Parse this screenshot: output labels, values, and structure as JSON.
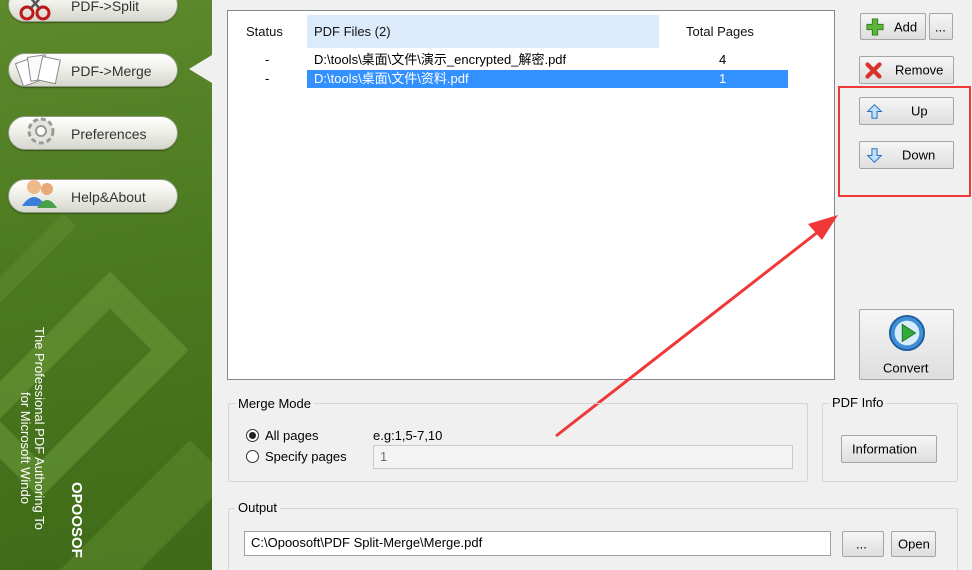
{
  "sidebar": {
    "items": [
      {
        "label": "PDF->Split",
        "icon": "scissors-icon"
      },
      {
        "label": "PDF->Merge",
        "icon": "pages-merge-icon"
      },
      {
        "label": "Preferences",
        "icon": "gear-icon"
      },
      {
        "label": "Help&About",
        "icon": "users-icon"
      }
    ],
    "tagline_line1": "The Professional PDF Authoring To",
    "tagline_line2": "for Microsoft Windo",
    "brand": "OPOOSOF"
  },
  "file_list": {
    "headers": {
      "status": "Status",
      "files": "PDF Files (2)",
      "pages": "Total Pages"
    },
    "rows": [
      {
        "status": "-",
        "file": "D:\\tools\\桌面\\文件\\演示_encrypted_解密.pdf",
        "pages": "4",
        "selected": false
      },
      {
        "status": "-",
        "file": "D:\\tools\\桌面\\文件\\资料.pdf",
        "pages": "1",
        "selected": true
      }
    ]
  },
  "actions": {
    "add": "Add",
    "more": "...",
    "remove": "Remove",
    "up": "Up",
    "down": "Down",
    "convert": "Convert"
  },
  "merge_mode": {
    "title": "Merge Mode",
    "all_pages": "All pages",
    "specify_pages": "Specify pages",
    "example": "e.g:1,5-7,10",
    "pages_value": "1",
    "selected": "all_pages"
  },
  "pdf_info": {
    "title": "PDF Info",
    "button": "Information"
  },
  "output": {
    "title": "Output",
    "path": "C:\\Opoosoft\\PDF Split-Merge\\Merge.pdf",
    "browse": "...",
    "open": "Open"
  },
  "colors": {
    "sidebar": "#4c7a20",
    "selection": "#3390ff",
    "annotation": "#f03838"
  }
}
